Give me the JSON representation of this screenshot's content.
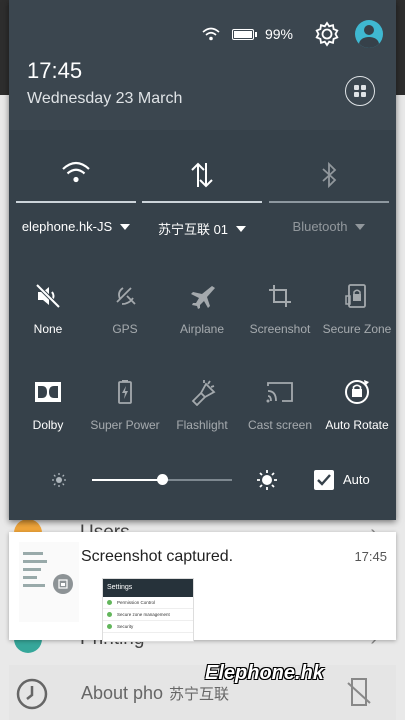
{
  "status_bar": {
    "battery_percent": "99%",
    "battery_level": 0.99
  },
  "header": {
    "time": "17:45",
    "date": "Wednesday 23 March"
  },
  "big_tiles": [
    {
      "label": "elephone.hk-JS",
      "icon": "wifi-icon",
      "active": true
    },
    {
      "label": "苏宁互联 01",
      "icon": "mobile-data-icon",
      "active": true
    },
    {
      "label": "Bluetooth",
      "icon": "bluetooth-icon",
      "active": false
    }
  ],
  "toggles_row1": [
    {
      "label": "None",
      "icon": "mute-icon",
      "active": true
    },
    {
      "label": "GPS",
      "icon": "gps-icon",
      "active": false
    },
    {
      "label": "Airplane",
      "icon": "airplane-icon",
      "active": false
    },
    {
      "label": "Screenshot",
      "icon": "crop-icon",
      "active": false
    },
    {
      "label": "Secure Zone",
      "icon": "secure-zone-icon",
      "active": false
    }
  ],
  "toggles_row2": [
    {
      "label": "Dolby",
      "icon": "dolby-icon",
      "active": true
    },
    {
      "label": "Super Power",
      "icon": "battery-bolt-icon",
      "active": false
    },
    {
      "label": "Flashlight",
      "icon": "flashlight-icon",
      "active": false
    },
    {
      "label": "Cast screen",
      "icon": "cast-icon",
      "active": false
    },
    {
      "label": "Auto Rotate",
      "icon": "auto-rotate-icon",
      "active": true
    }
  ],
  "brightness": {
    "level": 0.5,
    "auto_label": "Auto",
    "auto_checked": true
  },
  "notification": {
    "title": "Screenshot captured.",
    "time": "17:45",
    "preview": {
      "header": "Settings",
      "rows": [
        "Permission Control",
        "Secure zone management",
        "Security"
      ]
    }
  },
  "background_page": {
    "rows": [
      "Users",
      "Printing",
      "About pho"
    ]
  },
  "watermark": {
    "cn_text": "苏宁互联",
    "brand": "Elephone.hk"
  }
}
